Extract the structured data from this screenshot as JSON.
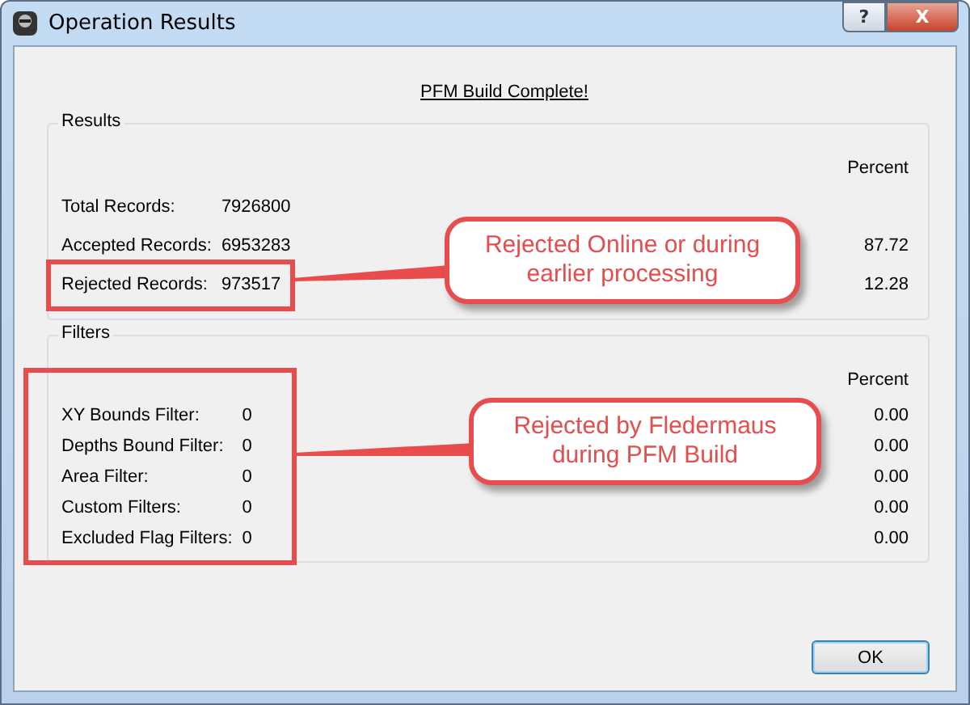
{
  "window": {
    "title": "Operation Results",
    "buttons": [
      {
        "kind": "help",
        "label": "?"
      },
      {
        "kind": "close",
        "label": "X"
      }
    ]
  },
  "heading": "PFM Build Complete!",
  "results": {
    "title": "Results",
    "percent_header": "Percent",
    "rows": [
      {
        "label": "Total Records:",
        "value": "7926800"
      },
      {
        "label": "Accepted Records:",
        "value": "6953283",
        "percent": "87.72"
      },
      {
        "label": "Rejected Records:",
        "value": "973517",
        "percent": "12.28"
      }
    ]
  },
  "filters": {
    "title": "Filters",
    "percent_header": "Percent",
    "rows": [
      {
        "label": "XY Bounds Filter:",
        "value": "0",
        "percent": "0.00"
      },
      {
        "label": "Depths Bound Filter:",
        "value": "0",
        "percent": "0.00"
      },
      {
        "label": "Area Filter:",
        "value": "0",
        "percent": "0.00"
      },
      {
        "label": "Custom Filters:",
        "value": "0",
        "percent": "0.00"
      },
      {
        "label": "Excluded Flag Filters:",
        "value": "0",
        "percent": "0.00"
      }
    ]
  },
  "callouts": [
    {
      "text": "Rejected Online or during earlier processing"
    },
    {
      "text": "Rejected by Fledermaus during PFM Build"
    }
  ],
  "ok_button": "OK"
}
